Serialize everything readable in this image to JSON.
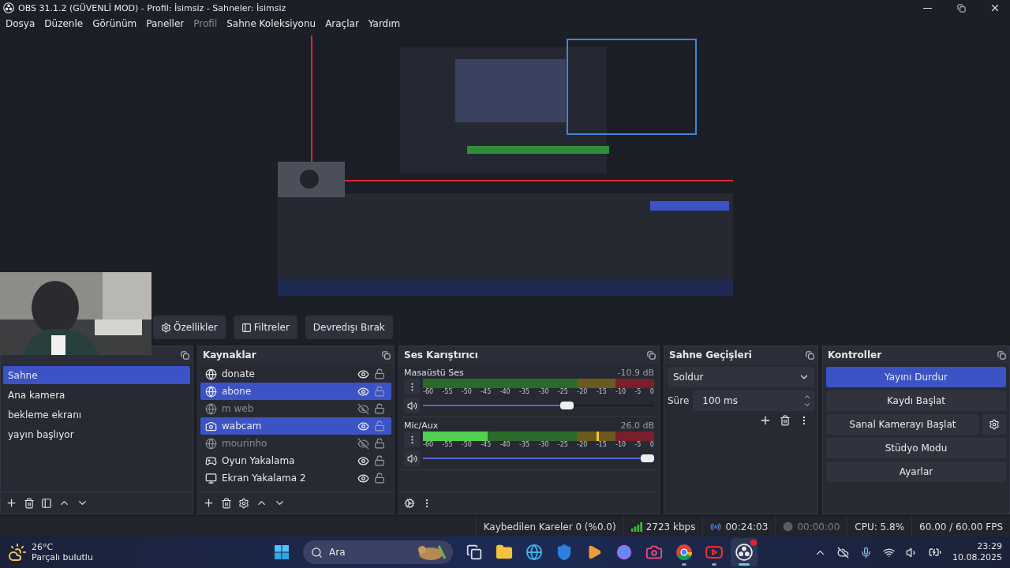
{
  "window": {
    "title": "OBS 31.1.2 (GÜVENLİ MOD) - Profil: İsimsiz - Sahneler: İsimsiz"
  },
  "menu": [
    {
      "label": "Dosya",
      "disabled": false
    },
    {
      "label": "Düzenle",
      "disabled": false
    },
    {
      "label": "Görünüm",
      "disabled": false
    },
    {
      "label": "Paneller",
      "disabled": false
    },
    {
      "label": "Profil",
      "disabled": true
    },
    {
      "label": "Sahne Koleksiyonu",
      "disabled": false
    },
    {
      "label": "Araçlar",
      "disabled": false
    },
    {
      "label": "Yardım",
      "disabled": false
    }
  ],
  "source_toolbar": [
    {
      "label": "Özellikler",
      "kind": "properties"
    },
    {
      "label": "Filtreler",
      "kind": "filters"
    },
    {
      "label": "Devredışı Bırak",
      "kind": "plain"
    }
  ],
  "scenes": {
    "items": [
      {
        "label": "Sahne",
        "selected": true
      },
      {
        "label": "Ana kamera",
        "selected": false
      },
      {
        "label": "bekleme ekranı",
        "selected": false
      },
      {
        "label": "yayın başlıyor",
        "selected": false
      }
    ]
  },
  "sources": {
    "title": "Kaynaklar",
    "items": [
      {
        "name": "donate",
        "kind": "browser",
        "selected": false,
        "visible": true
      },
      {
        "name": "abone",
        "kind": "browser",
        "selected": true,
        "visible": true
      },
      {
        "name": "m web",
        "kind": "browser",
        "selected": false,
        "visible": false
      },
      {
        "name": "wabcam",
        "kind": "camera",
        "selected": true,
        "visible": true
      },
      {
        "name": "mourinho",
        "kind": "browser",
        "selected": false,
        "visible": false
      },
      {
        "name": "Oyun Yakalama",
        "kind": "game",
        "selected": false,
        "visible": true
      },
      {
        "name": "Ekran Yakalama 2",
        "kind": "display",
        "selected": false,
        "visible": true
      }
    ]
  },
  "mixer": {
    "title": "Ses Karıştırıcı",
    "channels": [
      {
        "name": "Masaüstü Ses",
        "reading": "-10.9 dB",
        "volume": {
          "level": 0.63
        },
        "scale": [
          "-60",
          "-55",
          "-50",
          "-45",
          "-40",
          "-35",
          "-30",
          "-25",
          "-20",
          "-15",
          "-10",
          "-5",
          "0"
        ]
      },
      {
        "name": "Mic/Aux",
        "reading": "26.0 dB",
        "meter": {
          "level": 0.28
        },
        "peak": {
          "level": 0.75
        },
        "volume": {
          "level": 1
        },
        "scale": [
          "-60",
          "-55",
          "-50",
          "-45",
          "-40",
          "-35",
          "-30",
          "-25",
          "-20",
          "-15",
          "-10",
          "-5",
          "0"
        ]
      }
    ]
  },
  "transitions": {
    "title": "Sahne Geçişleri",
    "transition": "Soldur",
    "duration_label": "Süre",
    "duration": "100 ms"
  },
  "controls": {
    "title": "Kontroller",
    "buttons": [
      {
        "label": "Yayını Durdur",
        "active": true,
        "has_settings": false
      },
      {
        "label": "Kaydı Başlat",
        "active": false,
        "has_settings": false
      },
      {
        "label": "Sanal Kamerayı Başlat",
        "active": false,
        "has_settings": true
      },
      {
        "label": "Stüdyo Modu",
        "active": false,
        "has_settings": false
      },
      {
        "label": "Ayarlar",
        "active": false,
        "has_settings": false
      }
    ]
  },
  "status_bar": {
    "dropped": "Kaybedilen Kareler 0 (%0.0)",
    "bitrate": "2723 kbps",
    "stream_time": "00:24:03",
    "record_time": "00:00:00",
    "cpu": "CPU: 5.8%",
    "fps": "60.00 / 60.00 FPS"
  },
  "taskbar": {
    "temperature": "26°C",
    "weather": "Parçalı bulutlu",
    "search_placeholder": "Ara",
    "apps": [
      {
        "kind": "start",
        "open": false,
        "selected": false
      },
      {
        "kind": "taskview",
        "open": false,
        "selected": false
      },
      {
        "kind": "folder",
        "open": false,
        "selected": false
      },
      {
        "kind": "browser",
        "open": false,
        "selected": false
      },
      {
        "kind": "shield",
        "open": false,
        "selected": false
      },
      {
        "kind": "player",
        "open": false,
        "selected": false
      },
      {
        "kind": "copilot",
        "open": false,
        "selected": false
      },
      {
        "kind": "camera",
        "open": false,
        "selected": false
      },
      {
        "kind": "chrome",
        "open": true,
        "selected": false
      },
      {
        "kind": "video",
        "open": true,
        "selected": false
      },
      {
        "kind": "obs",
        "open": true,
        "selected": true
      }
    ],
    "time": "23:29",
    "date": "10.08.2025"
  }
}
